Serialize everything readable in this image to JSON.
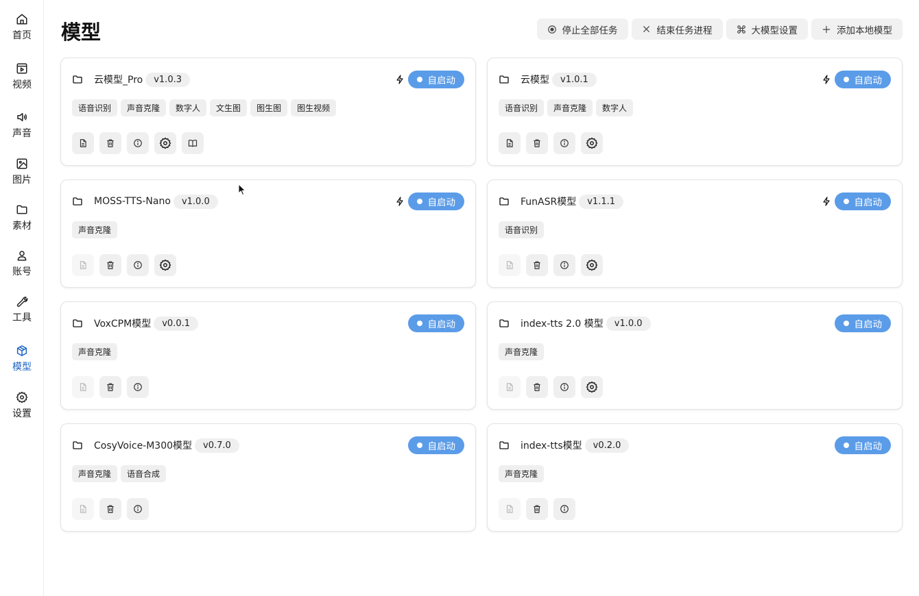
{
  "sidebar": {
    "items": [
      {
        "label": "首页",
        "icon": "home-icon",
        "active": false
      },
      {
        "label": "视频",
        "icon": "video-icon",
        "active": false
      },
      {
        "label": "声音",
        "icon": "speaker-icon",
        "active": false
      },
      {
        "label": "图片",
        "icon": "image-icon",
        "active": false
      },
      {
        "label": "素材",
        "icon": "folder-icon",
        "active": false
      },
      {
        "label": "账号",
        "icon": "user-icon",
        "active": false
      },
      {
        "label": "工具",
        "icon": "wrench-icon",
        "active": false
      },
      {
        "label": "模型",
        "icon": "cube-icon",
        "active": true
      },
      {
        "label": "设置",
        "icon": "gear-icon",
        "active": false
      }
    ]
  },
  "header": {
    "title": "模型",
    "buttons": [
      {
        "label": "停止全部任务",
        "icon": "stop-circle-icon"
      },
      {
        "label": "结束任务进程",
        "icon": "close-icon"
      },
      {
        "label": "大模型设置",
        "icon": "command-icon"
      },
      {
        "label": "添加本地模型",
        "icon": "plus-icon"
      }
    ]
  },
  "auto_start_label": "自启动",
  "colors": {
    "accent": "#5b9ce8",
    "active_nav": "#1e63c4",
    "tag_bg": "#efefef"
  },
  "models": [
    {
      "name": "云模型_Pro",
      "version": "v1.0.3",
      "bolt": true,
      "tags": [
        "语音识别",
        "声音克隆",
        "数字人",
        "文生图",
        "图生图",
        "图生视频"
      ],
      "actions": [
        {
          "icon": "document-icon",
          "enabled": true
        },
        {
          "icon": "trash-icon",
          "enabled": true
        },
        {
          "icon": "info-icon",
          "enabled": true
        },
        {
          "icon": "gear-icon",
          "enabled": true
        },
        {
          "icon": "book-icon",
          "enabled": true
        }
      ]
    },
    {
      "name": "云模型",
      "version": "v1.0.1",
      "bolt": true,
      "tags": [
        "语音识别",
        "声音克隆",
        "数字人"
      ],
      "actions": [
        {
          "icon": "document-icon",
          "enabled": true
        },
        {
          "icon": "trash-icon",
          "enabled": true
        },
        {
          "icon": "info-icon",
          "enabled": true
        },
        {
          "icon": "gear-icon",
          "enabled": true
        }
      ]
    },
    {
      "name": "MOSS-TTS-Nano",
      "version": "v1.0.0",
      "bolt": true,
      "tags": [
        "声音克隆"
      ],
      "actions": [
        {
          "icon": "document-icon",
          "enabled": false
        },
        {
          "icon": "trash-icon",
          "enabled": true
        },
        {
          "icon": "info-icon",
          "enabled": true
        },
        {
          "icon": "gear-icon",
          "enabled": true
        }
      ]
    },
    {
      "name": "FunASR模型",
      "version": "v1.1.1",
      "bolt": true,
      "tags": [
        "语音识别"
      ],
      "actions": [
        {
          "icon": "document-icon",
          "enabled": false
        },
        {
          "icon": "trash-icon",
          "enabled": true
        },
        {
          "icon": "info-icon",
          "enabled": true
        },
        {
          "icon": "gear-icon",
          "enabled": true
        }
      ]
    },
    {
      "name": "VoxCPM模型",
      "version": "v0.0.1",
      "bolt": false,
      "tags": [
        "声音克隆"
      ],
      "actions": [
        {
          "icon": "document-icon",
          "enabled": false
        },
        {
          "icon": "trash-icon",
          "enabled": true
        },
        {
          "icon": "info-icon",
          "enabled": true
        }
      ]
    },
    {
      "name": "index-tts 2.0 模型",
      "version": "v1.0.0",
      "bolt": false,
      "tags": [
        "声音克隆"
      ],
      "actions": [
        {
          "icon": "document-icon",
          "enabled": false
        },
        {
          "icon": "trash-icon",
          "enabled": true
        },
        {
          "icon": "info-icon",
          "enabled": true
        },
        {
          "icon": "gear-icon",
          "enabled": true
        }
      ]
    },
    {
      "name": "CosyVoice-M300模型",
      "version": "v0.7.0",
      "bolt": false,
      "tags": [
        "声音克隆",
        "语音合成"
      ],
      "actions": [
        {
          "icon": "document-icon",
          "enabled": false
        },
        {
          "icon": "trash-icon",
          "enabled": true
        },
        {
          "icon": "info-icon",
          "enabled": true
        }
      ]
    },
    {
      "name": "index-tts模型",
      "version": "v0.2.0",
      "bolt": false,
      "tags": [
        "声音克隆"
      ],
      "actions": [
        {
          "icon": "document-icon",
          "enabled": false
        },
        {
          "icon": "trash-icon",
          "enabled": true
        },
        {
          "icon": "info-icon",
          "enabled": true
        }
      ]
    }
  ]
}
